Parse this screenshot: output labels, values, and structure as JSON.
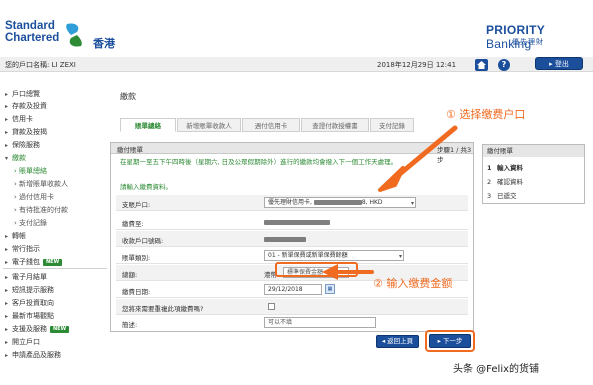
{
  "bank": {
    "name_line1": "Standard",
    "name_line2": "Chartered",
    "name_cn": "香港",
    "priority_a": "PRIORITY",
    "priority_b": "Banking",
    "priority_cn": "優先理財"
  },
  "userbar": {
    "account_name": "您的戶口名稱: LI ZEXI",
    "datetime": "2018年12月29日 12:41",
    "help": "?",
    "logout": "登出"
  },
  "sidebar": {
    "items": [
      {
        "label": "戶口總覽",
        "arrow": "▸"
      },
      {
        "label": "存款及投資",
        "arrow": "▸"
      },
      {
        "label": "信用卡",
        "arrow": "▸"
      },
      {
        "label": "貸款及按揭",
        "arrow": "▸"
      },
      {
        "label": "保險服務",
        "arrow": "▸"
      },
      {
        "label": "繳款",
        "arrow": "▾"
      },
      {
        "label": "賬單總絡"
      },
      {
        "label": "新增賬單收款人"
      },
      {
        "label": "過付信用卡"
      },
      {
        "label": "有待批准的付款"
      },
      {
        "label": "支付記錄"
      },
      {
        "label": "轉帳",
        "arrow": "▸"
      },
      {
        "label": "常行指示",
        "arrow": "▸"
      },
      {
        "label": "電子錢包",
        "arrow": "▸",
        "badge": "NEW"
      },
      {
        "label": "電子月結單",
        "arrow": "▸"
      },
      {
        "label": "短訊提示服務",
        "arrow": "▸"
      },
      {
        "label": "客戶投資取向",
        "arrow": "▸"
      },
      {
        "label": "最新市場觀點",
        "arrow": "▸"
      },
      {
        "label": "支援及服務",
        "arrow": "▸",
        "badge": "NEW"
      },
      {
        "label": "開立戶口",
        "arrow": "▸"
      },
      {
        "label": "申請產品及服務",
        "arrow": "▸"
      }
    ]
  },
  "main": {
    "title": "繳款",
    "tabs": [
      "賬單總絡",
      "新增賬單收款人",
      "週付信用卡",
      "查證付款授權書",
      "支付記錄"
    ],
    "panel_title": "繳付賬單",
    "step": "步驟1 / 共3步",
    "notice": "在星期一至五下午四時後（星期六, 日及公眾假期除外）進行的繳款均會撥入下一個工作天處理。",
    "prompt": "請輸入繳費資料。",
    "form": {
      "from_label": "支賬戶口:",
      "from_value": "優先理財信用卡, ",
      "from_suffix": "8, HKD",
      "to_label": "繳費至:",
      "recipient_label": "收款戶口號碼:",
      "type_label": "賬單類別:",
      "type_value": "01 - 新單保費或新單保費餘額",
      "amount_label": "總額:",
      "currency": "港幣",
      "amount_placeholder": "標準保費金額",
      "date_label": "繳費日期:",
      "date_value": "29/12/2018",
      "recurring_label": "您將來需要重複此項繳費嗎?",
      "remark_label": "簡述:",
      "remark_placeholder": "可以不填"
    },
    "back_button": "返回上頁",
    "next_button": "下一步"
  },
  "steps_panel": {
    "title": "繳付賬單",
    "items": [
      {
        "num": "1",
        "label": "輸入資料"
      },
      {
        "num": "2",
        "label": "確認資料"
      },
      {
        "num": "3",
        "label": "已遞交"
      }
    ]
  },
  "annotations": {
    "choose_account": "① 选择缴费户口",
    "enter_amount": "② 输入缴费金额",
    "color": "#f06a20"
  },
  "watermark": "头条 @Felix的货铺"
}
